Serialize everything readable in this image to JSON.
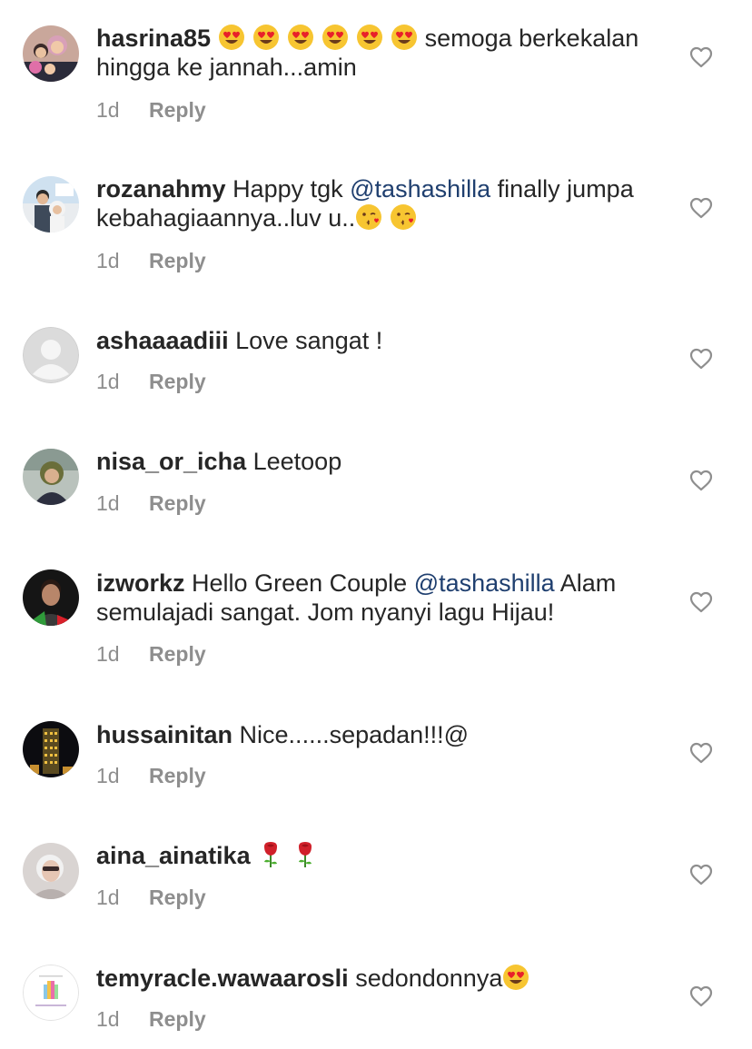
{
  "comments": [
    {
      "username": "hasrina85",
      "parts": [
        {
          "type": "emoji",
          "icon": "heart-eyes-emoji"
        },
        {
          "type": "emoji",
          "icon": "heart-eyes-emoji"
        },
        {
          "type": "emoji",
          "icon": "heart-eyes-emoji"
        },
        {
          "type": "emoji",
          "icon": "heart-eyes-emoji"
        },
        {
          "type": "emoji",
          "icon": "heart-eyes-emoji"
        },
        {
          "type": "emoji",
          "icon": "heart-eyes-emoji"
        },
        {
          "type": "text",
          "text": "semoga berkekalan hingga ke jannah...amin"
        }
      ],
      "time": "1d",
      "reply_label": "Reply",
      "avatar": "family-photo-avatar"
    },
    {
      "username": "rozanahmy",
      "parts": [
        {
          "type": "text",
          "text": "Happy tgk "
        },
        {
          "type": "mention",
          "text": "@tashashilla"
        },
        {
          "type": "text",
          "text": " finally jumpa kebahagiaannya..luv u.."
        },
        {
          "type": "emoji",
          "icon": "kissing-face-emoji"
        },
        {
          "type": "emoji",
          "icon": "kissing-face-emoji"
        }
      ],
      "time": "1d",
      "reply_label": "Reply",
      "avatar": "couple-photo-avatar"
    },
    {
      "username": "ashaaaadiii",
      "parts": [
        {
          "type": "text",
          "text": "Love sangat !"
        }
      ],
      "time": "1d",
      "reply_label": "Reply",
      "avatar": "default-user-avatar"
    },
    {
      "username": "nisa_or_icha",
      "parts": [
        {
          "type": "text",
          "text": "Leetoop"
        }
      ],
      "time": "1d",
      "reply_label": "Reply",
      "avatar": "portrait-avatar"
    },
    {
      "username": "izworkz",
      "parts": [
        {
          "type": "text",
          "text": "Hello Green Couple "
        },
        {
          "type": "mention",
          "text": "@tashashilla"
        },
        {
          "type": "text",
          "text": " Alam semulajadi sangat. Jom nyanyi lagu Hijau!"
        }
      ],
      "time": "1d",
      "reply_label": "Reply",
      "avatar": "man-portrait-avatar"
    },
    {
      "username": "hussainitan",
      "parts": [
        {
          "type": "text",
          "text": "Nice......sepadan!!!@"
        }
      ],
      "time": "1d",
      "reply_label": "Reply",
      "avatar": "night-building-avatar"
    },
    {
      "username": "aina_ainatika",
      "parts": [
        {
          "type": "emoji",
          "icon": "rose-emoji"
        },
        {
          "type": "emoji",
          "icon": "rose-emoji"
        }
      ],
      "time": "1d",
      "reply_label": "Reply",
      "avatar": "woman-portrait-avatar"
    },
    {
      "username": "temyracle.wawaarosli",
      "parts": [
        {
          "type": "text",
          "text": "sedondonnya"
        },
        {
          "type": "emoji",
          "icon": "heart-eyes-emoji"
        }
      ],
      "time": "1d",
      "reply_label": "Reply",
      "avatar": "logo-avatar"
    }
  ],
  "colors": {
    "text": "#262626",
    "meta": "#8e8e8e",
    "mention": "#1f3f6f",
    "heart_outline": "#8e8e8e"
  }
}
